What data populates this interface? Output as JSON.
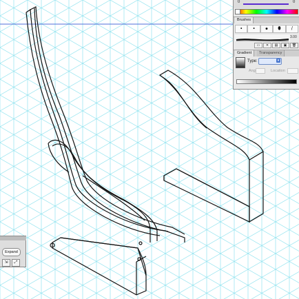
{
  "colors": {
    "grid": "#8fe3ef",
    "guide": "#4f6dd9",
    "stroke": "#111111",
    "panel_bg": "#e8e8e8",
    "accent": "#4a78d0"
  },
  "color_panel": {
    "slider_value_left": "0",
    "slider_value_right": "0"
  },
  "brushes_panel": {
    "tab_label": "Brushes",
    "cells": [
      "•",
      "•",
      "●",
      "⬮",
      "/"
    ],
    "count_label": "3.00",
    "tools": [
      "▭",
      "✕",
      "▤",
      "▣",
      "🗑"
    ]
  },
  "gradient_panel": {
    "tabs": [
      "Gradient",
      "Transparency"
    ],
    "type_label": "Type:",
    "type_value": "",
    "angle_label": "Angle",
    "location_label": "Location"
  },
  "left_panel": {
    "expand_label": "Expand",
    "icons": [
      "⇲",
      "⤢"
    ]
  }
}
